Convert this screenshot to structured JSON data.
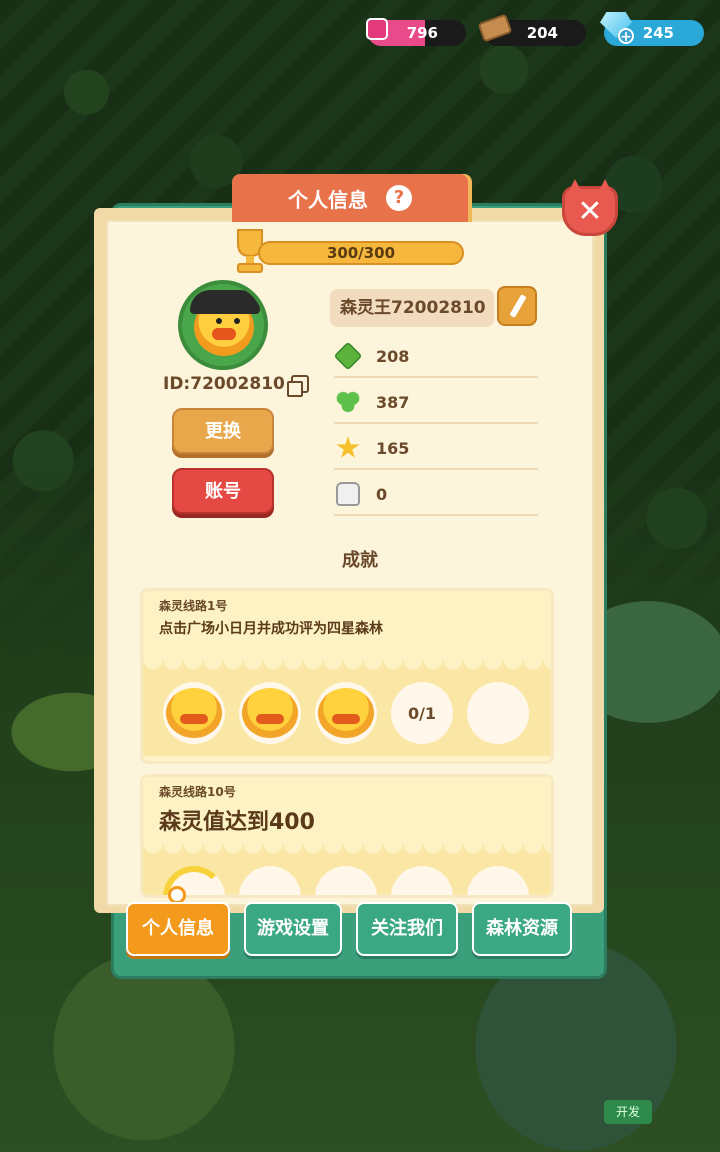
{
  "resources": {
    "potion": {
      "value": "796",
      "icon": "potion-icon"
    },
    "wood": {
      "value": "204",
      "icon": "wood-log-icon"
    },
    "gem": {
      "value": "245",
      "icon": "gem-icon"
    }
  },
  "panel": {
    "title": "个人信息",
    "help_icon": "?",
    "close_label": "✕"
  },
  "profile": {
    "level_progress": "300/300",
    "name": "森灵王72002810",
    "id_text": "ID:72002810",
    "change_button": "更换",
    "account_button": "账号",
    "stats": [
      {
        "icon": "grass-icon",
        "value": "208"
      },
      {
        "icon": "clover-icon",
        "value": "387"
      },
      {
        "icon": "star-icon",
        "value": "165"
      },
      {
        "icon": "thumbs-up-icon",
        "value": "0"
      }
    ]
  },
  "achievements": {
    "title": "成就",
    "items": [
      {
        "route": "森灵线路1号",
        "description": "点击广场小日月并成功评为四星森林",
        "progress": "0/1"
      },
      {
        "route": "森灵线路10号",
        "description": "森灵值达到400"
      }
    ]
  },
  "tabs": [
    {
      "label": "个人信息",
      "active": true
    },
    {
      "label": "游戏设置",
      "active": false
    },
    {
      "label": "关注我们",
      "active": false
    },
    {
      "label": "森林资源",
      "active": false
    }
  ],
  "dev_badge": "开发",
  "colors": {
    "panel_bg": "#fdf4dc",
    "frame_green": "#3b9f7c",
    "title_orange": "#e8734a",
    "active_tab": "#f39a1c",
    "account_red": "#e44a43"
  }
}
